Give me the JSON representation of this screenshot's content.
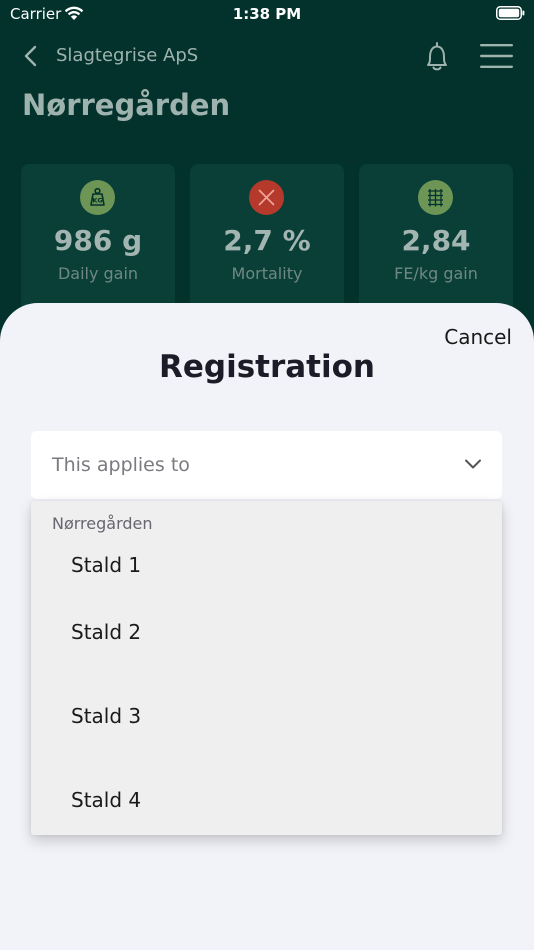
{
  "status_bar": {
    "carrier": "Carrier",
    "time": "1:38 PM"
  },
  "nav": {
    "company": "Slagtegrise ApS",
    "icons": [
      "chevron-left-icon",
      "bell-icon",
      "menu-icon"
    ]
  },
  "farm": {
    "title": "Nørregården"
  },
  "stats": [
    {
      "value": "986 g",
      "label": "Daily gain",
      "icon": "weight-icon",
      "icon_color": "#7fa55a"
    },
    {
      "value": "2,7 %",
      "label": "Mortality",
      "icon": "cross-icon",
      "icon_color": "#c93a2a"
    },
    {
      "value": "2,84",
      "label": "FE/kg gain",
      "icon": "feed-icon",
      "icon_color": "#7fa55a"
    }
  ],
  "sheet": {
    "cancel_label": "Cancel",
    "title": "Registration",
    "select_placeholder": "This applies to",
    "dropdown": {
      "group": "Nørregården",
      "items": [
        "Stald 1",
        "Stald 2",
        "Stald 3",
        "Stald 4"
      ]
    }
  },
  "colors": {
    "background": "#03322c",
    "sheet": "#f2f3f8",
    "card": "#0a3f38"
  }
}
